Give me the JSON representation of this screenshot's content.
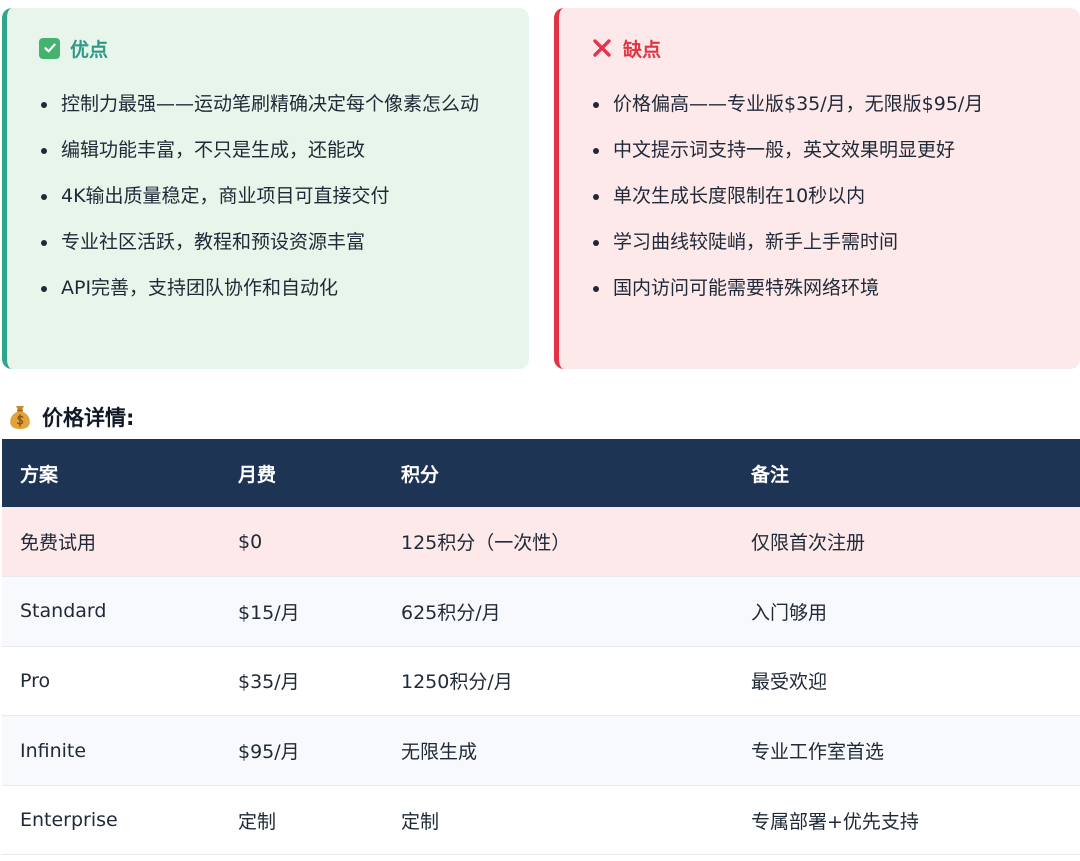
{
  "pros": {
    "title": "优点",
    "items": [
      "控制力最强——运动笔刷精确决定每个像素怎么动",
      "编辑功能丰富，不只是生成，还能改",
      "4K输出质量稳定，商业项目可直接交付",
      "专业社区活跃，教程和预设资源丰富",
      "API完善，支持团队协作和自动化"
    ]
  },
  "cons": {
    "title": "缺点",
    "items": [
      "价格偏高——专业版$35/月，无限版$95/月",
      "中文提示词支持一般，英文效果明显更好",
      "单次生成长度限制在10秒以内",
      "学习曲线较陡峭，新手上手需时间",
      "国内访问可能需要特殊网络环境"
    ]
  },
  "pricing": {
    "heading": "价格详情:",
    "columns": [
      "方案",
      "月费",
      "积分",
      "备注"
    ],
    "rows": [
      [
        "免费试用",
        "$0",
        "125积分（一次性）",
        "仅限首次注册"
      ],
      [
        "Standard",
        "$15/月",
        "625积分/月",
        "入门够用"
      ],
      [
        "Pro",
        "$35/月",
        "1250积分/月",
        "最受欢迎"
      ],
      [
        "Infinite",
        "$95/月",
        "无限生成",
        "专业工作室首选"
      ],
      [
        "Enterprise",
        "定制",
        "定制",
        "专属部署+优先支持"
      ]
    ]
  },
  "icons": {
    "pros": "check-box-icon",
    "cons": "cross-mark-icon",
    "pricing": "money-bag-icon"
  },
  "colors": {
    "pros_accent": "#2fa58a",
    "cons_accent": "#e03444",
    "table_header": "#1e3455",
    "highlight_row": "#fde8ea"
  }
}
